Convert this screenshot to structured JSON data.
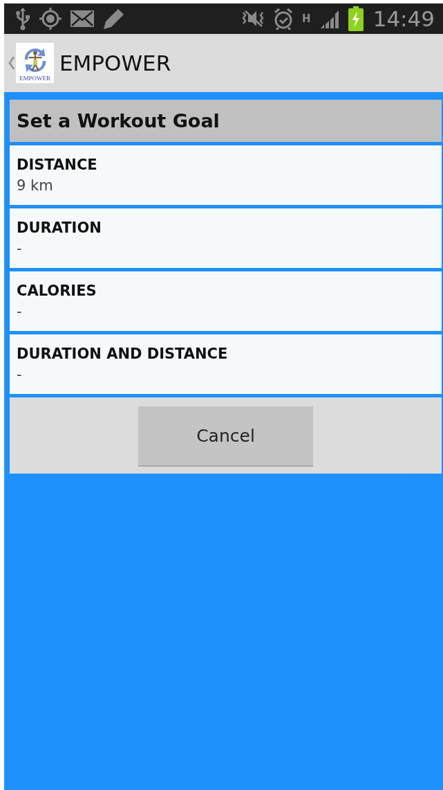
{
  "status_bar": {
    "network_type": "H",
    "time": "14:49"
  },
  "app_bar": {
    "logo_text": "EMPOWER",
    "title": "EMPOWER"
  },
  "dialog": {
    "title": "Set a Workout Goal",
    "options": [
      {
        "label": "DISTANCE",
        "value": "9 km"
      },
      {
        "label": "DURATION",
        "value": "-"
      },
      {
        "label": "CALORIES",
        "value": "-"
      },
      {
        "label": "DURATION AND DISTANCE",
        "value": "-"
      }
    ],
    "buttons": [
      "Cancel"
    ]
  }
}
